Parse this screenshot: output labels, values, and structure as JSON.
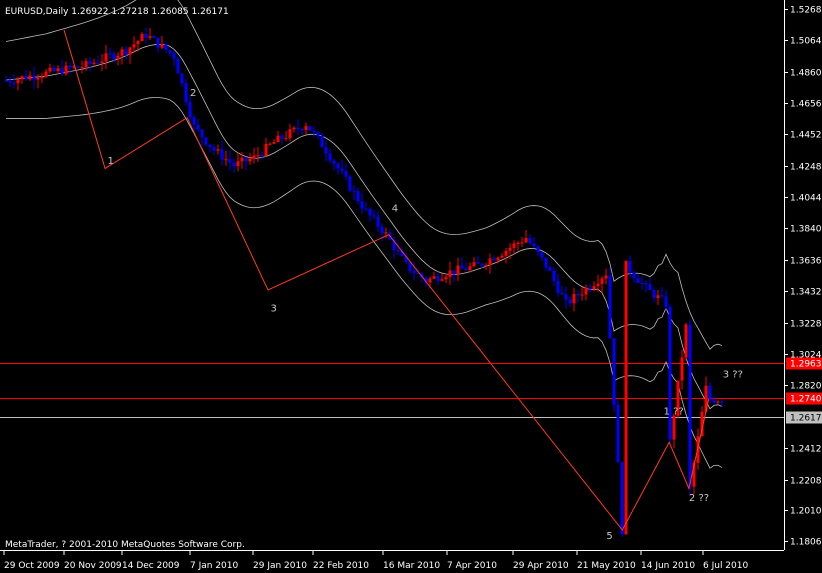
{
  "chart_data": {
    "type": "candlestick",
    "header": "EURUSD,Daily  1.26922 1.27218 1.26085 1.26171",
    "copyright": "MetaTrader, ? 2001-2010 MetaQuotes Software Corp.",
    "ylim": [
      1.175,
      1.5325
    ],
    "y_ticks": [
      "1.52680",
      "1.50640",
      "1.48600",
      "1.46560",
      "1.44520",
      "1.42480",
      "1.40440",
      "1.38400",
      "1.36360",
      "1.34320",
      "1.32280",
      "1.30240",
      "1.28200",
      "1.24120",
      "1.22080",
      "1.20100",
      "1.18060"
    ],
    "x_ticks": [
      "29 Oct 2009",
      "20 Nov 2009",
      "14 Dec 2009",
      "7 Jan 2010",
      "29 Jan 2010",
      "22 Feb 2010",
      "16 Mar 2010",
      "7 Apr 2010",
      "29 Apr 2010",
      "21 May 2010",
      "14 Jun 2010",
      "6 Jul 2010"
    ],
    "levels": [
      {
        "value": 1.29632,
        "label": "1.29632",
        "color": "#ff0000"
      },
      {
        "value": 1.27408,
        "label": "1.27408",
        "color": "#ff0000"
      },
      {
        "value": 1.26171,
        "label": "1.26171",
        "color": "#c0c0c0"
      }
    ],
    "up_color": "#ff0000",
    "down_color": "#0000ff",
    "band_color": "#bebebe",
    "zigzag_color": "#ff3c1e",
    "candle_count": 180,
    "waypoints": [
      [
        0,
        1.48
      ],
      [
        20,
        1.49
      ],
      [
        25,
        1.495
      ],
      [
        30,
        1.5
      ],
      [
        35,
        1.51
      ],
      [
        42,
        1.496
      ],
      [
        47,
        1.45
      ],
      [
        52,
        1.435
      ],
      [
        57,
        1.425
      ],
      [
        62,
        1.43
      ],
      [
        67,
        1.44
      ],
      [
        75,
        1.452
      ],
      [
        80,
        1.435
      ],
      [
        85,
        1.415
      ],
      [
        90,
        1.395
      ],
      [
        95,
        1.38
      ],
      [
        100,
        1.36
      ],
      [
        105,
        1.35
      ],
      [
        110,
        1.355
      ],
      [
        118,
        1.36
      ],
      [
        125,
        1.37
      ],
      [
        130,
        1.378
      ],
      [
        135,
        1.36
      ],
      [
        140,
        1.335
      ],
      [
        145,
        1.345
      ],
      [
        150,
        1.355
      ],
      [
        155,
        1.36
      ],
      [
        160,
        1.345
      ],
      [
        165,
        1.335
      ],
      [
        170,
        1.32
      ],
      [
        175,
        1.28
      ]
    ],
    "band_offsets": [
      [
        0,
        0.025
      ],
      [
        40,
        0.035
      ],
      [
        80,
        0.03
      ],
      [
        120,
        0.025
      ],
      [
        140,
        0.03
      ],
      [
        165,
        0.035
      ],
      [
        180,
        0.04
      ]
    ],
    "zigzag_points": [
      [
        "20 Nov 2009",
        1.513
      ],
      [
        "7 Dec 2009",
        1.423
      ],
      [
        "6 Jan 2010",
        1.456
      ],
      [
        "4 Feb 2010",
        1.344
      ],
      [
        "18 Mar 2010",
        1.38
      ],
      [
        "7 Jun 2010",
        1.188
      ],
      [
        "24 Jun 2010",
        1.245
      ],
      [
        "1 Jul 2010",
        1.215
      ],
      [
        "8 Jul 2010",
        1.273
      ]
    ],
    "wave_labels": [
      {
        "text": "1",
        "x": "8 Dec 2009",
        "y": 1.426
      },
      {
        "text": "2",
        "x": "7 Jan 2010",
        "y": 1.47
      },
      {
        "text": "3",
        "x": "5 Feb 2010",
        "y": 1.33
      },
      {
        "text": "4",
        "x": "19 Mar 2010",
        "y": 1.395
      },
      {
        "text": "5",
        "x": "1 Jun 2010",
        "y": 1.182
      },
      {
        "text": "1 ??",
        "x": "22 Jun 2010",
        "y": 1.263
      },
      {
        "text": "2 ??",
        "x": "1 Jul 2010",
        "y": 1.207
      },
      {
        "text": "3 ??",
        "x": "13 Jul 2010",
        "y": 1.287
      }
    ]
  }
}
